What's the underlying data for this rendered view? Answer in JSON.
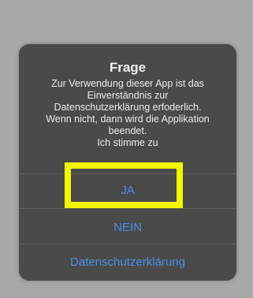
{
  "dialog": {
    "title": "Frage",
    "message": "Zur Verwendung dieser App ist das\nEinverständnis zur\nDatenschutzerklärung erfoderlich.\nWenn nicht, dann wird die Applikation\nbeendet.\nIch stimme zu",
    "buttons": {
      "yes_label": "JA",
      "no_label": "NEIN",
      "privacy_label": "Datenschutzerklärung"
    }
  },
  "annotation": {
    "highlight_color": "#f5f500",
    "highlight_target": "JA"
  },
  "colors": {
    "backdrop": "#a8a8a8",
    "dialog_bg": "#4a4a4a",
    "button_text": "#4b8fe3",
    "title_text": "#f2f2f2"
  }
}
